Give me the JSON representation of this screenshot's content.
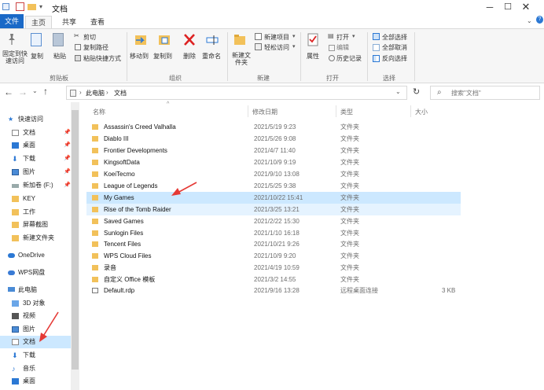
{
  "window": {
    "title": "文档"
  },
  "ribbon_tabs": [
    "文件",
    "主页",
    "共享",
    "查看"
  ],
  "ribbon": {
    "clipboard": {
      "pin_quick": "固定到快速访问",
      "copy": "复制",
      "paste": "粘贴",
      "cut": "剪切",
      "copy_path": "复制路径",
      "paste_shortcut": "粘贴快捷方式",
      "group": "剪贴板"
    },
    "organize": {
      "move_to": "移动到",
      "copy_to": "复制到",
      "delete": "删除",
      "rename": "重命名",
      "group": "组织"
    },
    "new": {
      "new_folder": "新建文件夹",
      "new_item": "新建项目",
      "easy_access": "轻松访问",
      "group": "新建"
    },
    "open": {
      "properties": "属性",
      "open": "打开",
      "edit": "编辑",
      "history": "历史记录",
      "group": "打开"
    },
    "select": {
      "select_all": "全部选择",
      "select_none": "全部取消",
      "invert": "反向选择",
      "group": "选择"
    }
  },
  "address": {
    "crumb1": "此电脑",
    "crumb2": "文档",
    "search_placeholder": "搜索\"文档\""
  },
  "nav": {
    "quick_access": "快速访问",
    "items": [
      "文档",
      "桌面",
      "下载",
      "图片",
      "新加卷 (F:)",
      "KEY",
      "工作",
      "屏幕截图",
      "新建文件夹"
    ],
    "onedrive": "OneDrive",
    "wps": "WPS网盘",
    "this_pc": "此电脑",
    "pc_items": [
      "3D 对象",
      "视频",
      "图片",
      "文档",
      "下载",
      "音乐",
      "桌面"
    ]
  },
  "columns": {
    "name": "名称",
    "date": "修改日期",
    "type": "类型",
    "size": "大小"
  },
  "files": [
    {
      "name": "Assassin's Creed Valhalla",
      "date": "2021/5/19 9:23",
      "type": "文件夹",
      "size": ""
    },
    {
      "name": "Diablo III",
      "date": "2021/5/26 9:08",
      "type": "文件夹",
      "size": ""
    },
    {
      "name": "Frontier Developments",
      "date": "2021/4/7 11:40",
      "type": "文件夹",
      "size": ""
    },
    {
      "name": "KingsoftData",
      "date": "2021/10/9 9:19",
      "type": "文件夹",
      "size": ""
    },
    {
      "name": "KoeiTecmo",
      "date": "2021/9/10 13:08",
      "type": "文件夹",
      "size": ""
    },
    {
      "name": "League of Legends",
      "date": "2021/5/25 9:38",
      "type": "文件夹",
      "size": ""
    },
    {
      "name": "My Games",
      "date": "2021/10/22 15:41",
      "type": "文件夹",
      "size": ""
    },
    {
      "name": "Rise of the Tomb Raider",
      "date": "2021/3/25 13:21",
      "type": "文件夹",
      "size": ""
    },
    {
      "name": "Saved Games",
      "date": "2021/2/22 15:30",
      "type": "文件夹",
      "size": ""
    },
    {
      "name": "Sunlogin Files",
      "date": "2021/1/10 16:18",
      "type": "文件夹",
      "size": ""
    },
    {
      "name": "Tencent Files",
      "date": "2021/10/21 9:26",
      "type": "文件夹",
      "size": ""
    },
    {
      "name": "WPS Cloud Files",
      "date": "2021/10/9 9:20",
      "type": "文件夹",
      "size": ""
    },
    {
      "name": "录音",
      "date": "2021/4/19 10:59",
      "type": "文件夹",
      "size": ""
    },
    {
      "name": "自定义 Office 模板",
      "date": "2021/3/2 14:55",
      "type": "文件夹",
      "size": ""
    },
    {
      "name": "Default.rdp",
      "date": "2021/9/16 13:28",
      "type": "远程桌面连接",
      "size": "3 KB"
    }
  ]
}
